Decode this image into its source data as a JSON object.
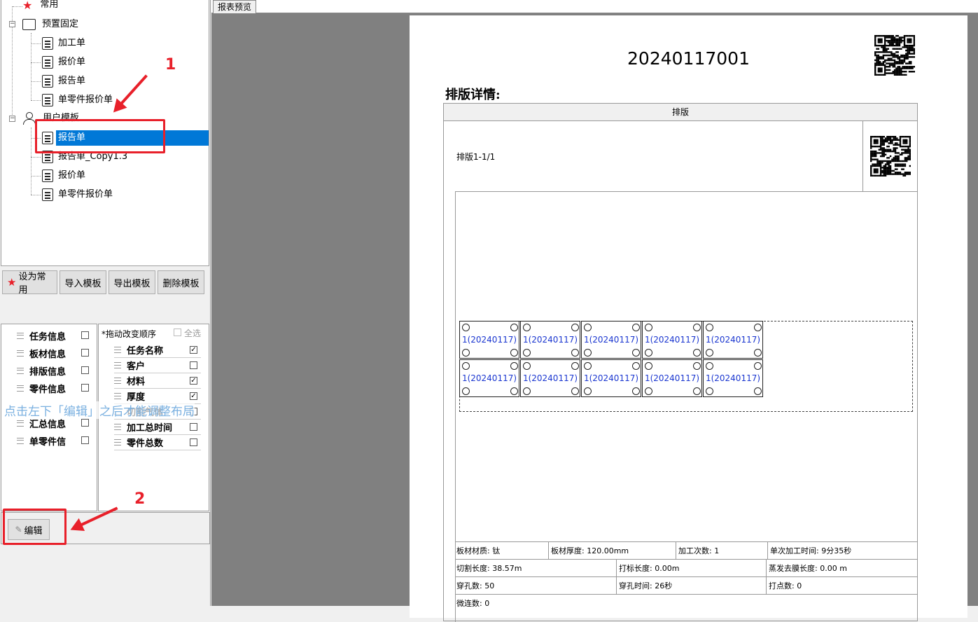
{
  "tree": {
    "favorites": "常用",
    "preset_group": "预置固定",
    "preset_items": [
      "加工单",
      "报价单",
      "报告单",
      "单零件报价单"
    ],
    "user_group": "用户模板",
    "user_items": [
      "报告单",
      "报告单_Copy1.3",
      "报价单",
      "单零件报价单"
    ],
    "selected_user_item": "报告单"
  },
  "buttons": {
    "set_favorite": "设为常用",
    "import": "导入模板",
    "export": "导出模板",
    "delete": "删除模板",
    "edit": "编辑"
  },
  "fields_left": [
    {
      "label": "任务信息",
      "checked": false
    },
    {
      "label": "板材信息",
      "checked": false
    },
    {
      "label": "排版信息",
      "checked": false
    },
    {
      "label": "零件信息",
      "checked": false
    },
    {
      "label": "汇总信息",
      "checked": false
    },
    {
      "label": "单零件信",
      "checked": false
    }
  ],
  "fields_right_header": {
    "hint": "*拖动改变顺序",
    "select_all": "全选"
  },
  "fields_right": [
    {
      "label": "任务名称",
      "checked": true
    },
    {
      "label": "客户",
      "checked": false
    },
    {
      "label": "材料",
      "checked": true
    },
    {
      "label": "厚度",
      "checked": true
    },
    {
      "label": "切割气体",
      "checked": false
    },
    {
      "label": "加工总时间",
      "checked": false
    },
    {
      "label": "零件总数",
      "checked": false
    }
  ],
  "watermark": "点击左下「编辑」之后才能调整布局",
  "annotations": {
    "step1": "1",
    "step2": "2"
  },
  "preview": {
    "tab": "报表预览",
    "report_number": "20240117001",
    "section_title": "排版详情:",
    "table_header": "排版",
    "layout_label": "排版1-1/1",
    "part_label": "1(20240117)",
    "rows": [
      [
        "板材材质: 钛",
        "板材厚度: 120.00mm",
        "加工次数: 1",
        "单次加工时间: 9分35秒"
      ],
      [
        "切割长度: 38.57m",
        "打标长度: 0.00m",
        "蒸发去膜长度: 0.00 m"
      ],
      [
        "穿孔数: 50",
        "穿孔时间: 26秒",
        "打点数: 0"
      ],
      [
        "微连数: 0"
      ]
    ]
  },
  "colors": {
    "accent": "#0078d7",
    "annotation": "#e8202a",
    "part_text": "#1a36d0"
  }
}
